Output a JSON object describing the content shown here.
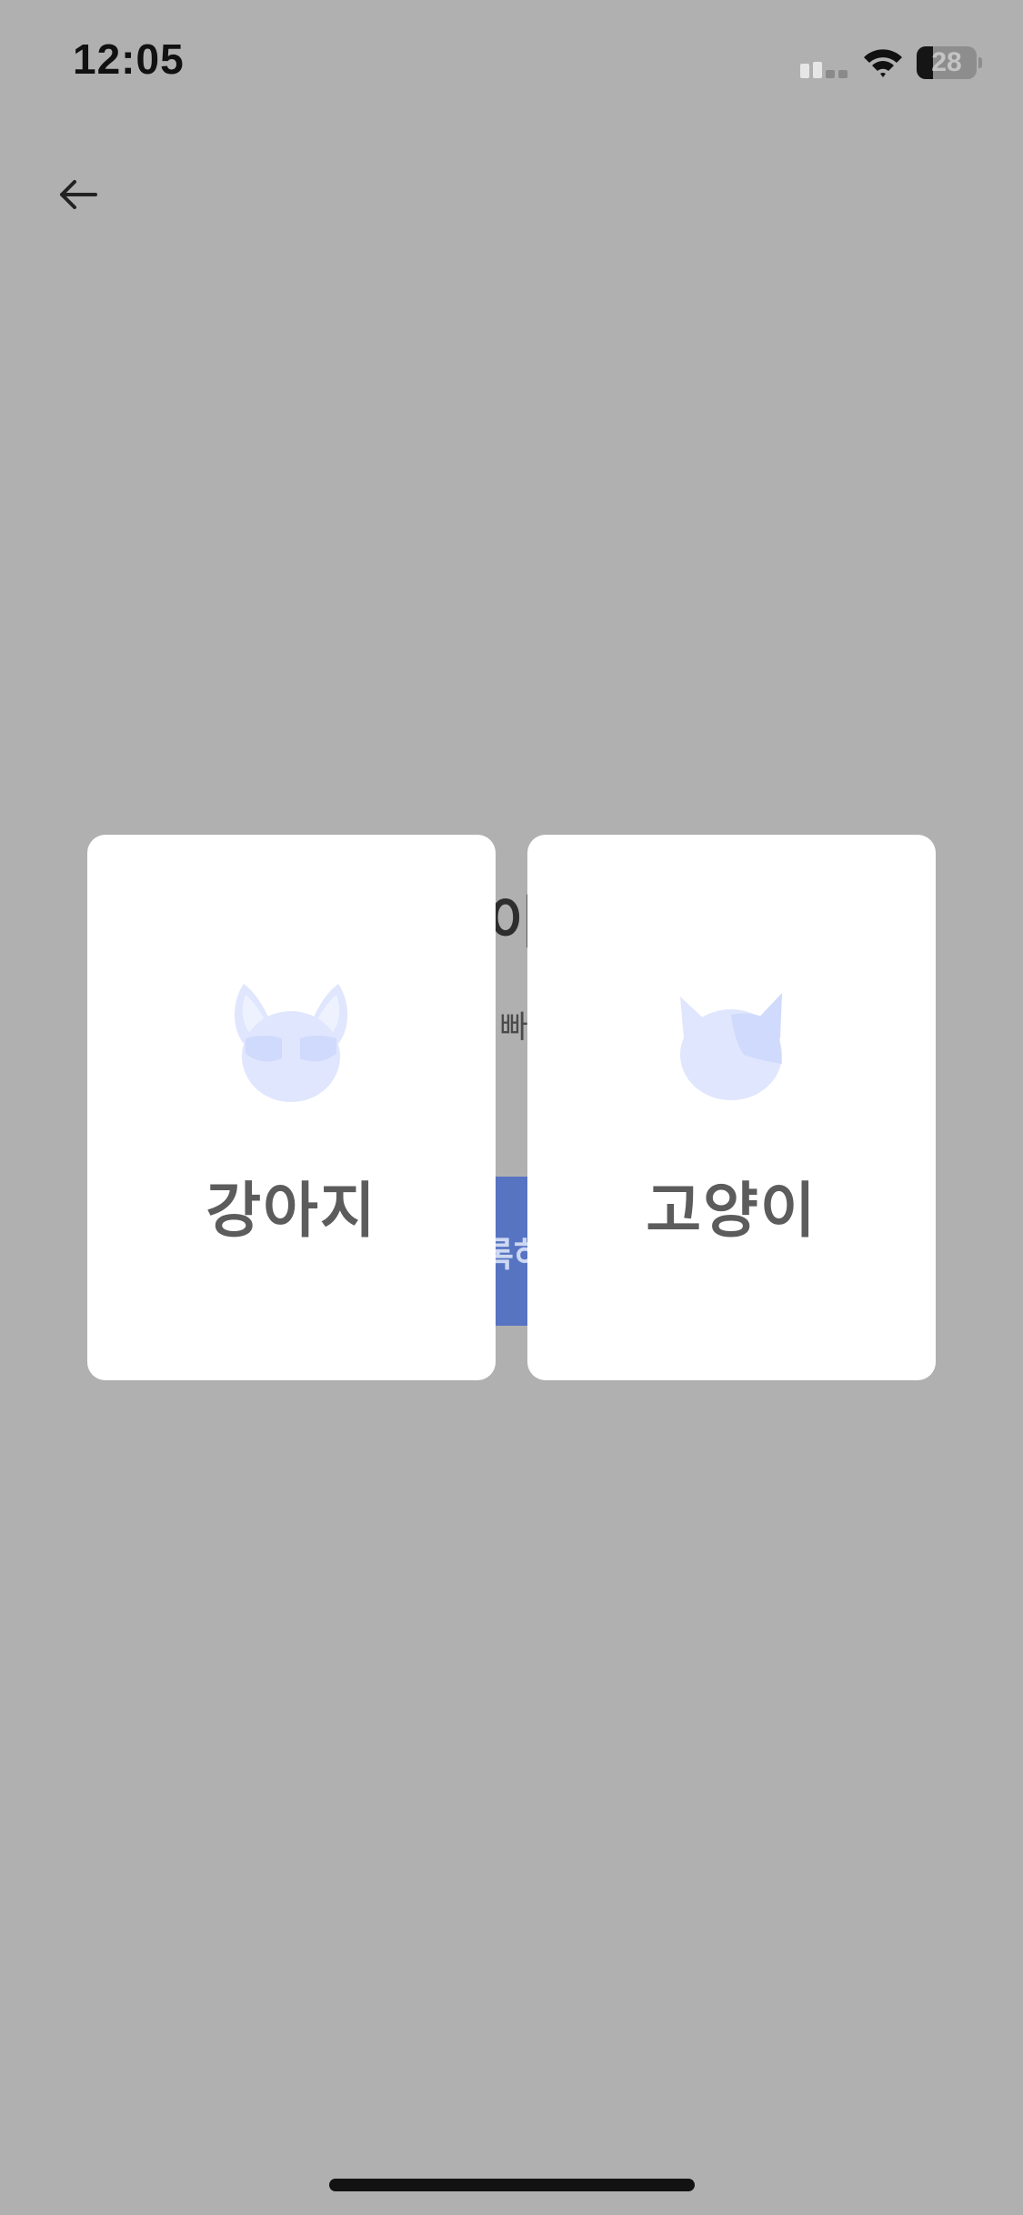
{
  "status_bar": {
    "time": "12:05",
    "battery_level": "28",
    "battery_fraction": 0.28,
    "icons": [
      "signal-icon",
      "wifi-icon",
      "battery-icon"
    ]
  },
  "nav": {
    "back_icon": "arrow-left-icon"
  },
  "background_page": {
    "title_partial": "이",
    "subtitle_partial": "빠",
    "register_button_partial": "록하"
  },
  "pet_options": {
    "dog": {
      "label": "강아지",
      "icon": "dog-face-icon"
    },
    "cat": {
      "label": "고양이",
      "icon": "cat-face-icon"
    }
  },
  "colors": {
    "overlay_background": "#b0b0b0",
    "card_background": "#ffffff",
    "card_label": "#5c5c5c",
    "illustration_light": "#dfe6fd",
    "illustration_mid": "#cfdafc",
    "dimmed_primary_button": "#5774c2"
  }
}
